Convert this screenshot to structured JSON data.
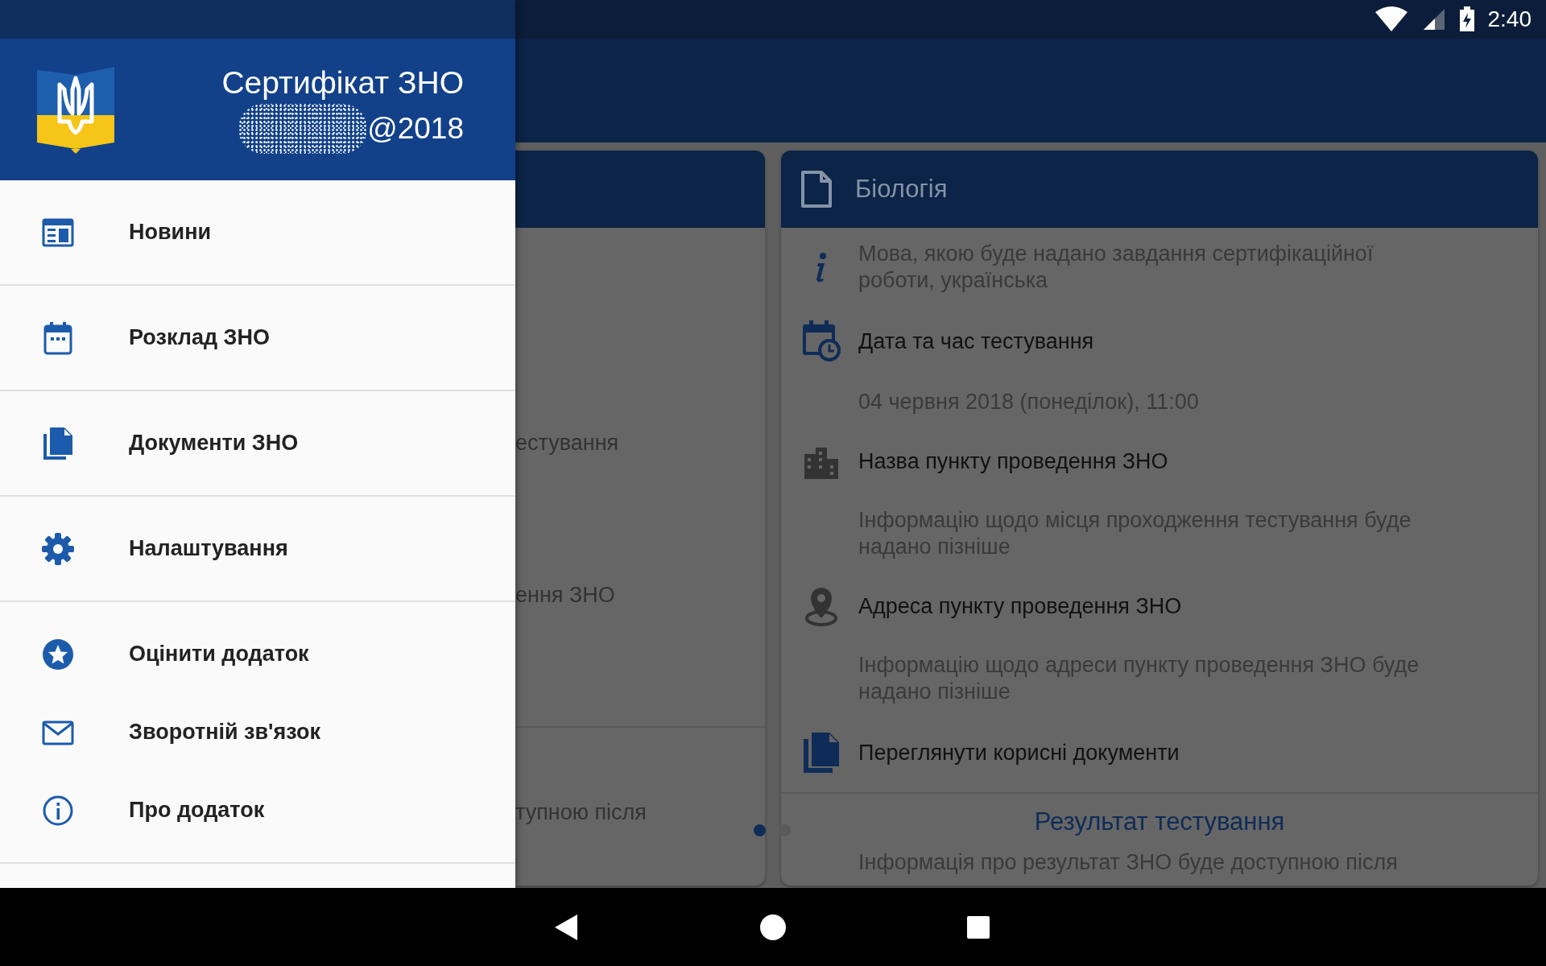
{
  "status_bar": {
    "time": "2:40"
  },
  "drawer": {
    "title": "Сертифікат ЗНО",
    "account": "@2018",
    "sections": [
      {
        "items": [
          {
            "label": "Новини"
          }
        ]
      },
      {
        "items": [
          {
            "label": "Розклад ЗНО"
          }
        ]
      },
      {
        "items": [
          {
            "label": "Документи ЗНО"
          }
        ]
      },
      {
        "items": [
          {
            "label": "Налаштування"
          }
        ]
      },
      {
        "items": [
          {
            "label": "Оцінити додаток"
          },
          {
            "label": "Зворотній зв'язок"
          },
          {
            "label": "Про додаток"
          }
        ]
      }
    ]
  },
  "pager": {
    "left_card": {
      "texts": [
        "естування",
        "ення ЗНО",
        "тупною після"
      ]
    },
    "right_card": {
      "title": "Біологія",
      "rows": [
        {
          "kind": "note",
          "text": "Мова, якою буде надано завдання сертифікаційної роботи, українська"
        },
        {
          "kind": "heading",
          "text": "Дата та час тестування"
        },
        {
          "kind": "detail",
          "text": "04 червня 2018 (понеділок), 11:00"
        },
        {
          "kind": "heading",
          "text": "Назва пункту проведення ЗНО"
        },
        {
          "kind": "detail",
          "text": "Інформацію щодо місця проходження тестування буде надано пізніше"
        },
        {
          "kind": "heading",
          "text": "Адреса пункту проведення ЗНО"
        },
        {
          "kind": "detail",
          "text": "Інформацію щодо адреси пункту проведення ЗНО буде надано пізніше"
        },
        {
          "kind": "heading",
          "text": "Переглянути корисні документи"
        }
      ],
      "section_title": "Результат тестування",
      "result_note": "Інформація про результат ЗНО буде доступною після"
    },
    "dots": [
      {
        "selected": true
      },
      {
        "selected": false
      }
    ]
  }
}
